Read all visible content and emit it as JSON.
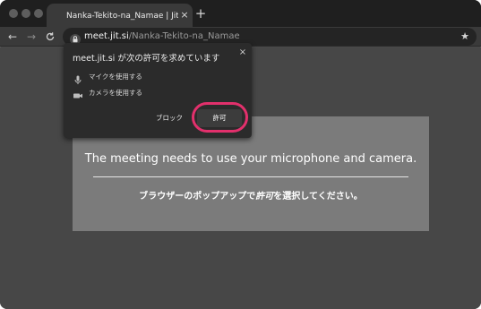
{
  "tab": {
    "title": "Nanka-Tekito-na_Namae | Jitsi Meet",
    "close_label": "×",
    "new_tab_label": "+"
  },
  "toolbar": {
    "back_label": "←",
    "forward_label": "→",
    "url_host": "meet.jit.si",
    "url_path": "/Nanka-Tekito-na_Namae",
    "bookmark_label": "★"
  },
  "permission_popup": {
    "title": "meet.jit.si が次の許可を求めています",
    "close_label": "×",
    "items": [
      {
        "icon": "microphone-icon",
        "label": "マイクを使用する"
      },
      {
        "icon": "camera-icon",
        "label": "カメラを使用する"
      }
    ],
    "block_label": "ブロック",
    "allow_label": "許可",
    "highlight_color": "#e2306c"
  },
  "overlay": {
    "title": "The meeting needs to use your microphone and camera.",
    "subtitle_before": "ブラウザーのポップアップで",
    "subtitle_emphasis": "許可",
    "subtitle_after": "を選択してください。"
  },
  "colors": {
    "tab_bar": "#1f1f1f",
    "toolbar": "#3a3a3a",
    "page_bg": "#474747",
    "overlay_bg": "#7b7b7b",
    "popup_bg": "#2b2b2b"
  }
}
